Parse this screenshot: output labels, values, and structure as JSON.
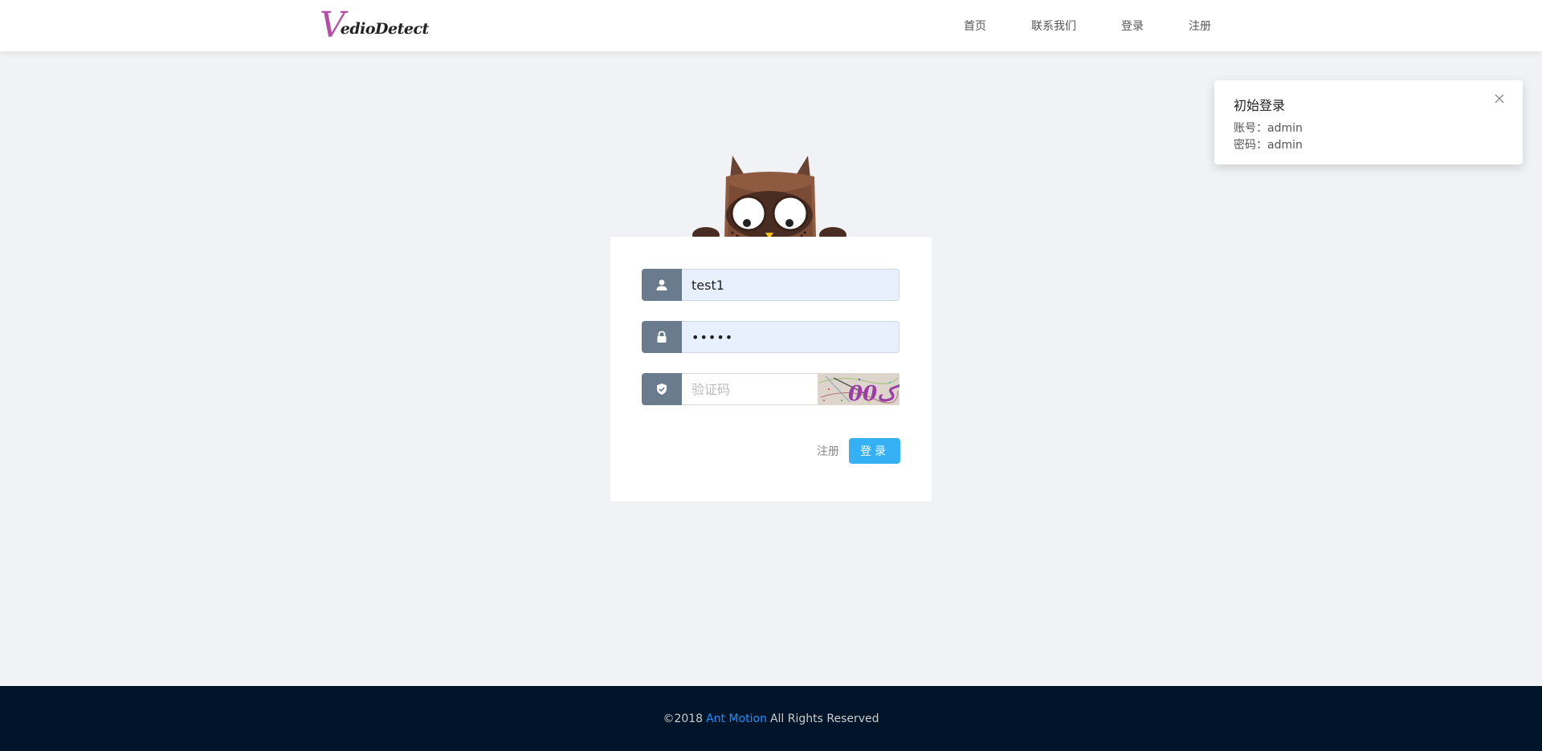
{
  "header": {
    "logo_first": "V",
    "logo_rest": "edioDetect",
    "nav": [
      "首页",
      "联系我们",
      "登录",
      "注册"
    ]
  },
  "notification": {
    "title": "初始登录",
    "account_line": "账号：admin",
    "password_line": "密码：admin"
  },
  "login_form": {
    "username_value": "test1",
    "password_value": "•••••",
    "captcha_placeholder": "验证码",
    "captcha_text": "0ک0",
    "register_label": "注册",
    "login_label": "登录"
  },
  "footer": {
    "prefix": "©2018",
    "link": "Ant Motion",
    "suffix": "All Rights Reserved"
  },
  "colors": {
    "accent_button": "#36b0f5",
    "icon_bg": "#6b7b8e",
    "footer_bg": "#001529",
    "footer_link": "#1890ff",
    "logo_accent": "#b44fa6"
  },
  "icons": [
    "user-icon",
    "lock-icon",
    "shield-check-icon",
    "close-icon",
    "owl-mascot"
  ]
}
